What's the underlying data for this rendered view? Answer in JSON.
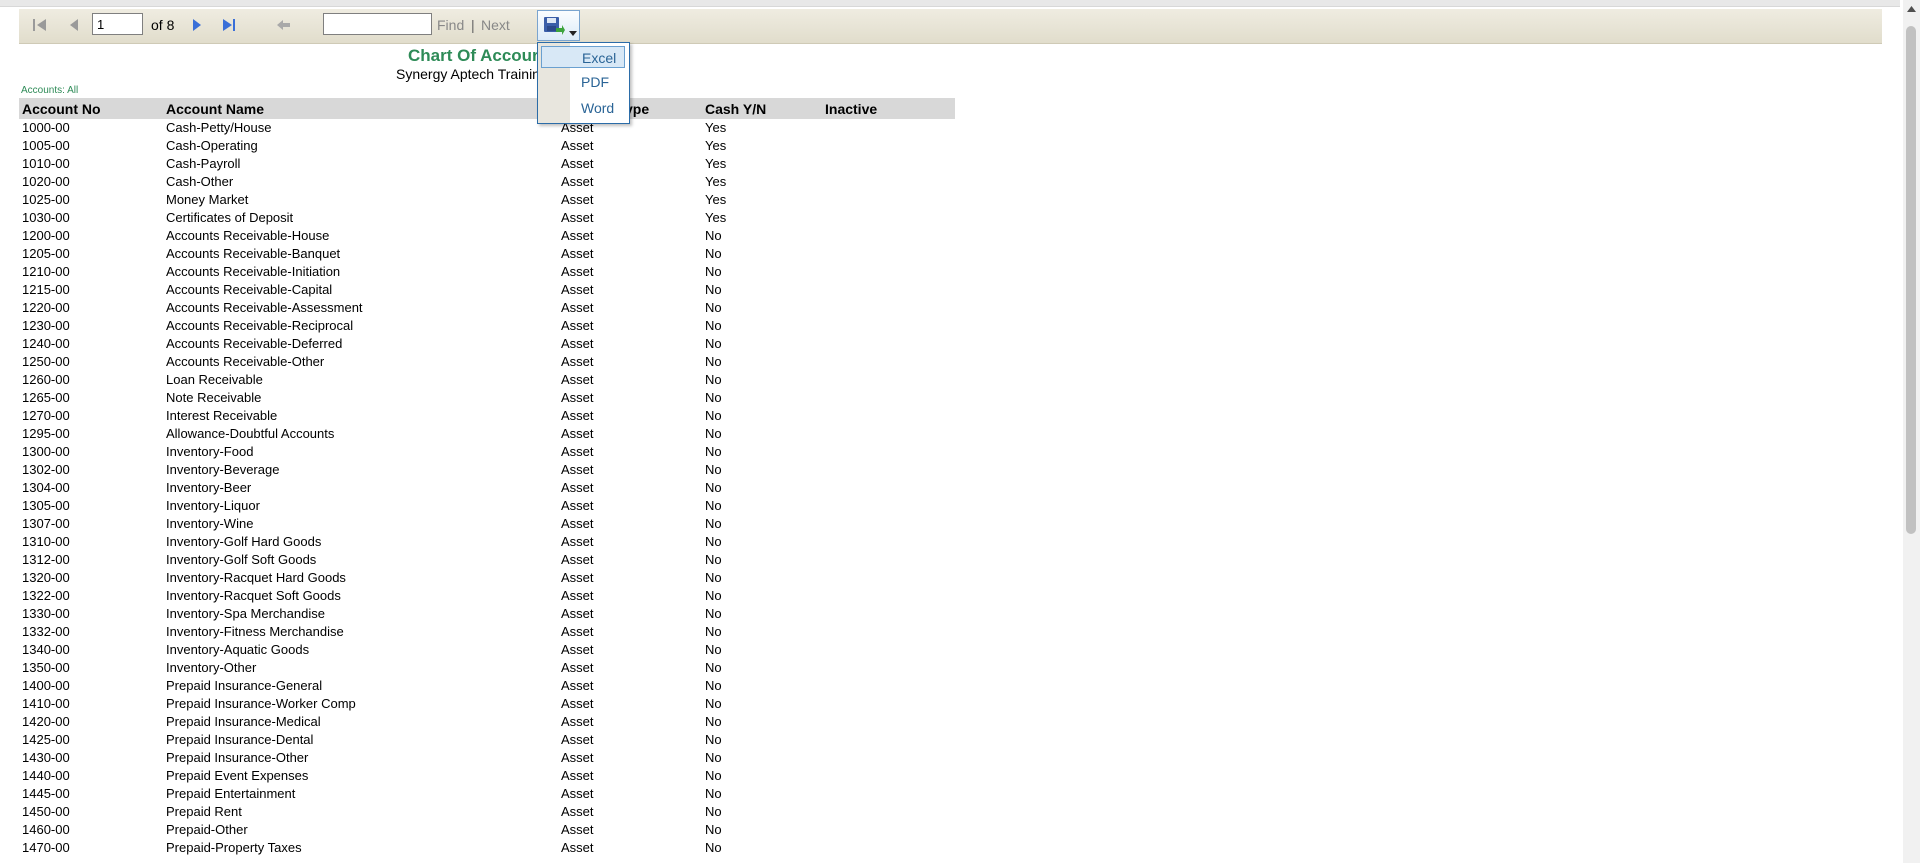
{
  "toolbar": {
    "page_value": "1",
    "of_pages": "of 8",
    "find_value": "",
    "find_label": "Find",
    "separator": "|",
    "next_label": "Next"
  },
  "export_menu": {
    "items": [
      "Excel",
      "PDF",
      "Word"
    ],
    "selected": "Excel"
  },
  "report": {
    "title": "Chart Of Accour",
    "subtitle": "Synergy Aptech Training",
    "filter_label": "Accounts: All",
    "columns": {
      "account_no": "Account No",
      "account_name": "Account Name",
      "type": "ype",
      "cash": "Cash Y/N",
      "inactive": "Inactive"
    },
    "rows": [
      {
        "no": "1000-00",
        "name": "Cash-Petty/House",
        "type": "Asset",
        "cash": "Yes"
      },
      {
        "no": "1005-00",
        "name": "Cash-Operating",
        "type": "Asset",
        "cash": "Yes"
      },
      {
        "no": "1010-00",
        "name": "Cash-Payroll",
        "type": "Asset",
        "cash": "Yes"
      },
      {
        "no": "1020-00",
        "name": "Cash-Other",
        "type": "Asset",
        "cash": "Yes"
      },
      {
        "no": "1025-00",
        "name": "Money Market",
        "type": "Asset",
        "cash": "Yes"
      },
      {
        "no": "1030-00",
        "name": "Certificates of Deposit",
        "type": "Asset",
        "cash": "Yes"
      },
      {
        "no": "1200-00",
        "name": "Accounts Receivable-House",
        "type": "Asset",
        "cash": "No"
      },
      {
        "no": "1205-00",
        "name": "Accounts Receivable-Banquet",
        "type": "Asset",
        "cash": "No"
      },
      {
        "no": "1210-00",
        "name": "Accounts Receivable-Initiation",
        "type": "Asset",
        "cash": "No"
      },
      {
        "no": "1215-00",
        "name": "Accounts Receivable-Capital",
        "type": "Asset",
        "cash": "No"
      },
      {
        "no": "1220-00",
        "name": "Accounts Receivable-Assessment",
        "type": "Asset",
        "cash": "No"
      },
      {
        "no": "1230-00",
        "name": "Accounts Receivable-Reciprocal",
        "type": "Asset",
        "cash": "No"
      },
      {
        "no": "1240-00",
        "name": "Accounts Receivable-Deferred",
        "type": "Asset",
        "cash": "No"
      },
      {
        "no": "1250-00",
        "name": "Accounts Receivable-Other",
        "type": "Asset",
        "cash": "No"
      },
      {
        "no": "1260-00",
        "name": "Loan Receivable",
        "type": "Asset",
        "cash": "No"
      },
      {
        "no": "1265-00",
        "name": "Note Receivable",
        "type": "Asset",
        "cash": "No"
      },
      {
        "no": "1270-00",
        "name": "Interest Receivable",
        "type": "Asset",
        "cash": "No"
      },
      {
        "no": "1295-00",
        "name": "Allowance-Doubtful Accounts",
        "type": "Asset",
        "cash": "No"
      },
      {
        "no": "1300-00",
        "name": "Inventory-Food",
        "type": "Asset",
        "cash": "No"
      },
      {
        "no": "1302-00",
        "name": "Inventory-Beverage",
        "type": "Asset",
        "cash": "No"
      },
      {
        "no": "1304-00",
        "name": "Inventory-Beer",
        "type": "Asset",
        "cash": "No"
      },
      {
        "no": "1305-00",
        "name": "Inventory-Liquor",
        "type": "Asset",
        "cash": "No"
      },
      {
        "no": "1307-00",
        "name": "Inventory-Wine",
        "type": "Asset",
        "cash": "No"
      },
      {
        "no": "1310-00",
        "name": "Inventory-Golf Hard Goods",
        "type": "Asset",
        "cash": "No"
      },
      {
        "no": "1312-00",
        "name": "Inventory-Golf Soft Goods",
        "type": "Asset",
        "cash": "No"
      },
      {
        "no": "1320-00",
        "name": "Inventory-Racquet Hard Goods",
        "type": "Asset",
        "cash": "No"
      },
      {
        "no": "1322-00",
        "name": "Inventory-Racquet Soft Goods",
        "type": "Asset",
        "cash": "No"
      },
      {
        "no": "1330-00",
        "name": "Inventory-Spa Merchandise",
        "type": "Asset",
        "cash": "No"
      },
      {
        "no": "1332-00",
        "name": "Inventory-Fitness Merchandise",
        "type": "Asset",
        "cash": "No"
      },
      {
        "no": "1340-00",
        "name": "Inventory-Aquatic Goods",
        "type": "Asset",
        "cash": "No"
      },
      {
        "no": "1350-00",
        "name": "Inventory-Other",
        "type": "Asset",
        "cash": "No"
      },
      {
        "no": "1400-00",
        "name": "Prepaid Insurance-General",
        "type": "Asset",
        "cash": "No"
      },
      {
        "no": "1410-00",
        "name": "Prepaid Insurance-Worker Comp",
        "type": "Asset",
        "cash": "No"
      },
      {
        "no": "1420-00",
        "name": "Prepaid Insurance-Medical",
        "type": "Asset",
        "cash": "No"
      },
      {
        "no": "1425-00",
        "name": "Prepaid Insurance-Dental",
        "type": "Asset",
        "cash": "No"
      },
      {
        "no": "1430-00",
        "name": "Prepaid Insurance-Other",
        "type": "Asset",
        "cash": "No"
      },
      {
        "no": "1440-00",
        "name": "Prepaid Event Expenses",
        "type": "Asset",
        "cash": "No"
      },
      {
        "no": "1445-00",
        "name": "Prepaid Entertainment",
        "type": "Asset",
        "cash": "No"
      },
      {
        "no": "1450-00",
        "name": "Prepaid Rent",
        "type": "Asset",
        "cash": "No"
      },
      {
        "no": "1460-00",
        "name": "Prepaid-Other",
        "type": "Asset",
        "cash": "No"
      },
      {
        "no": "1470-00",
        "name": "Prepaid-Property Taxes",
        "type": "Asset",
        "cash": "No"
      }
    ]
  },
  "colors": {
    "title": "#2e8b57",
    "toolbar_bg": "#e6e2d3",
    "header_bg": "#d8d8d8",
    "menu_text": "#2a6496"
  },
  "icons": {
    "first": "first-page-icon",
    "prev": "previous-page-icon",
    "next": "next-page-icon",
    "last": "last-page-icon",
    "back": "back-to-parent-icon",
    "export": "save-export-icon"
  }
}
